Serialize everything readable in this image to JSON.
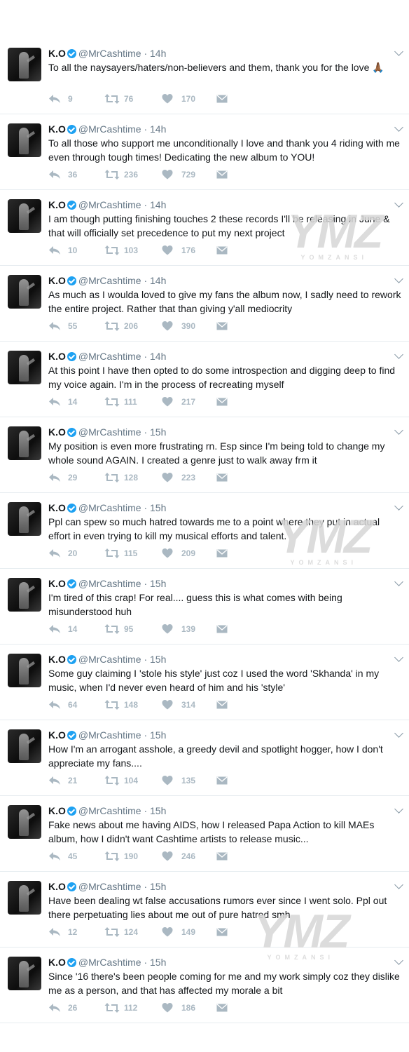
{
  "account": {
    "name": "K.O",
    "handle": "@MrCashtime"
  },
  "watermark": {
    "brand": "YMZ",
    "sub": "YOMZANSI"
  },
  "tweets": [
    {
      "time": "14h",
      "text": "To all the naysayers/haters/non-believers and them, thank you for the love 🙏🏾",
      "replies": "9",
      "retweets": "76",
      "likes": "170"
    },
    {
      "time": "14h",
      "text": "To all those who support me unconditionally I love and thank you 4 riding with me even through tough times! Dedicating the new album to YOU!",
      "replies": "36",
      "retweets": "236",
      "likes": "729"
    },
    {
      "time": "14h",
      "text": "I am though putting finishing touches 2 these records I'll be releasing in June & that will officially set precedence to put my next project",
      "replies": "10",
      "retweets": "103",
      "likes": "176"
    },
    {
      "time": "14h",
      "text": "As much as I woulda loved to give my fans the album now, I sadly need to rework the entire project. Rather that than giving y'all mediocrity",
      "replies": "55",
      "retweets": "206",
      "likes": "390"
    },
    {
      "time": "14h",
      "text": "At this point I have then opted to do some introspection and digging  deep to find my voice again. I'm in the process of recreating myself",
      "replies": "14",
      "retweets": "111",
      "likes": "217"
    },
    {
      "time": "15h",
      "text": "My position is even more frustrating rn. Esp since I'm being told to change my whole sound AGAIN. I created a genre just to walk away frm it",
      "replies": "29",
      "retweets": "128",
      "likes": "223"
    },
    {
      "time": "15h",
      "text": "Ppl can spew so much hatred towards me to a point where they put in actual effort in even trying to kill my musical efforts and talent.",
      "replies": "20",
      "retweets": "115",
      "likes": "209"
    },
    {
      "time": "15h",
      "text": "I'm tired of this crap! For real.... guess this is what comes with being misunderstood huh",
      "replies": "14",
      "retweets": "95",
      "likes": "139"
    },
    {
      "time": "15h",
      "text": "Some guy claiming I 'stole his style' just coz I used the word 'Skhanda' in my music, when I'd never even heard of him and his 'style'",
      "replies": "64",
      "retweets": "148",
      "likes": "314"
    },
    {
      "time": "15h",
      "text": "How I'm an arrogant asshole, a greedy devil and spotlight hogger, how I don't appreciate my fans....",
      "replies": "21",
      "retweets": "104",
      "likes": "135"
    },
    {
      "time": "15h",
      "text": "Fake news about me having AIDS, how I released Papa Action to kill MAEs album, how I didn't want Cashtime artists to release music...",
      "replies": "45",
      "retweets": "190",
      "likes": "246"
    },
    {
      "time": "15h",
      "text": "Have been dealing wt false accusations rumors ever since I went solo. Ppl out there perpetuating lies about me out of pure hatred smh",
      "replies": "12",
      "retweets": "124",
      "likes": "149"
    },
    {
      "time": "15h",
      "text": "Since '16 there's been people coming for me and my work simply coz they dislike me as a person, and that has affected my morale a bit",
      "replies": "26",
      "retweets": "112",
      "likes": "186"
    }
  ],
  "icons": {
    "reply": "reply-icon",
    "retweet": "retweet-icon",
    "like": "heart-icon",
    "dm": "envelope-icon",
    "verified": "verified-badge-icon",
    "menu": "chevron-down-icon"
  },
  "colors": {
    "text": "#14171a",
    "secondary": "#657786",
    "action": "#aab8c2",
    "verified": "#1da1f2",
    "divider": "#e6ecf0"
  }
}
